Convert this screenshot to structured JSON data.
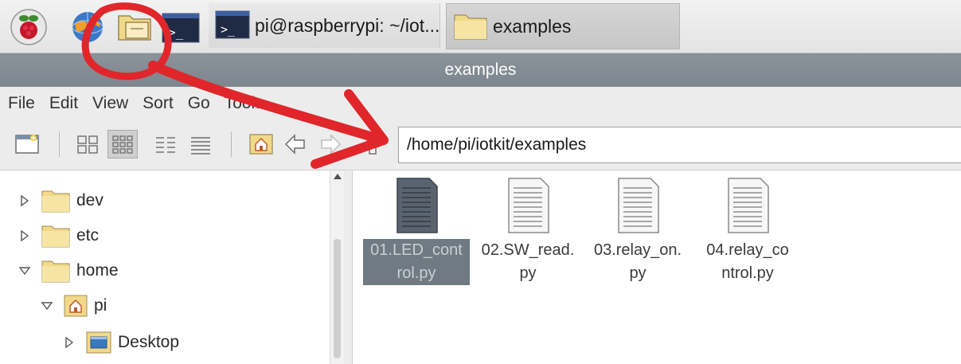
{
  "taskbar": {
    "tasks": [
      {
        "label": "pi@raspberrypi: ~/iot..."
      },
      {
        "label": "examples"
      }
    ]
  },
  "window": {
    "title": "examples"
  },
  "menubar": {
    "items": [
      "File",
      "Edit",
      "View",
      "Sort",
      "Go",
      "Tools"
    ]
  },
  "toolbar": {
    "path": "/home/pi/iotkit/examples"
  },
  "sidebar": {
    "tree": [
      {
        "label": "dev"
      },
      {
        "label": "etc"
      },
      {
        "label": "home"
      },
      {
        "label": "pi"
      },
      {
        "label": "Desktop"
      }
    ]
  },
  "files": [
    {
      "name": "01.LED_control.py",
      "line1": "01.LED_cont",
      "line2": "rol.py"
    },
    {
      "name": "02.SW_read.py",
      "line1": "02.SW_read.",
      "line2": "py"
    },
    {
      "name": "03.relay_on.py",
      "line1": "03.relay_on.",
      "line2": "py"
    },
    {
      "name": "04.relay_control.py",
      "line1": "04.relay_co",
      "line2": "ntrol.py"
    }
  ],
  "colors": {
    "annotation": "#e0262a",
    "titlebar": "#848c94",
    "selection": "#6f7a82",
    "folder": "#f2d98a"
  },
  "icons": {
    "menu": "raspberry-pi-logo-icon",
    "browser": "web-browser-globe-icon",
    "files": "file-manager-icon",
    "terminal": "terminal-icon"
  }
}
